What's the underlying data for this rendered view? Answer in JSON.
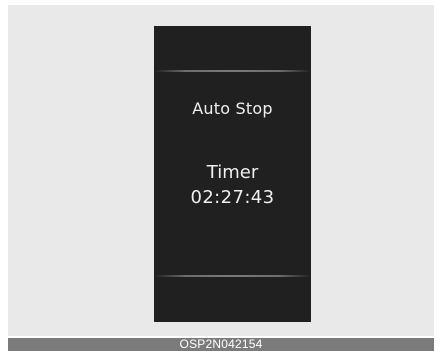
{
  "display": {
    "status_text": "Auto Stop",
    "timer_label": "Timer",
    "timer_value": "02:27:43"
  },
  "footer": {
    "code": "OSP2N042154"
  }
}
